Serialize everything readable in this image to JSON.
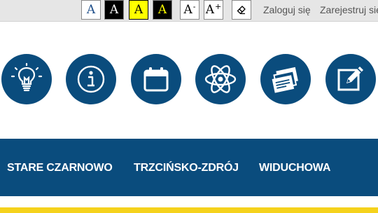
{
  "accessibility": {
    "contrast_buttons": [
      {
        "label": "A",
        "scheme": "default"
      },
      {
        "label": "A",
        "scheme": "white-on-black"
      },
      {
        "label": "A",
        "scheme": "black-on-yellow"
      },
      {
        "label": "A",
        "scheme": "yellow-on-black"
      }
    ],
    "font_decrease": {
      "label": "A",
      "sign": "-"
    },
    "font_increase": {
      "label": "A",
      "sign": "+"
    },
    "reset_icon": "eraser-icon"
  },
  "user_links": {
    "login": "Zaloguj się",
    "register": "Zarejestruj się"
  },
  "quick_icons": [
    {
      "icon": "lightbulb-icon"
    },
    {
      "icon": "info-icon"
    },
    {
      "icon": "calendar-icon"
    },
    {
      "icon": "atom-icon"
    },
    {
      "icon": "documents-icon"
    },
    {
      "icon": "edit-icon"
    }
  ],
  "nav": {
    "items": [
      "STARE CZARNOWO",
      "TRZCIŃSKO-ZDRÓJ",
      "WIDUCHOWA"
    ]
  },
  "colors": {
    "brand_blue": "#0a4c7d",
    "accent_yellow": "#f5d21c",
    "topbar_bg": "#e6e6e6"
  }
}
